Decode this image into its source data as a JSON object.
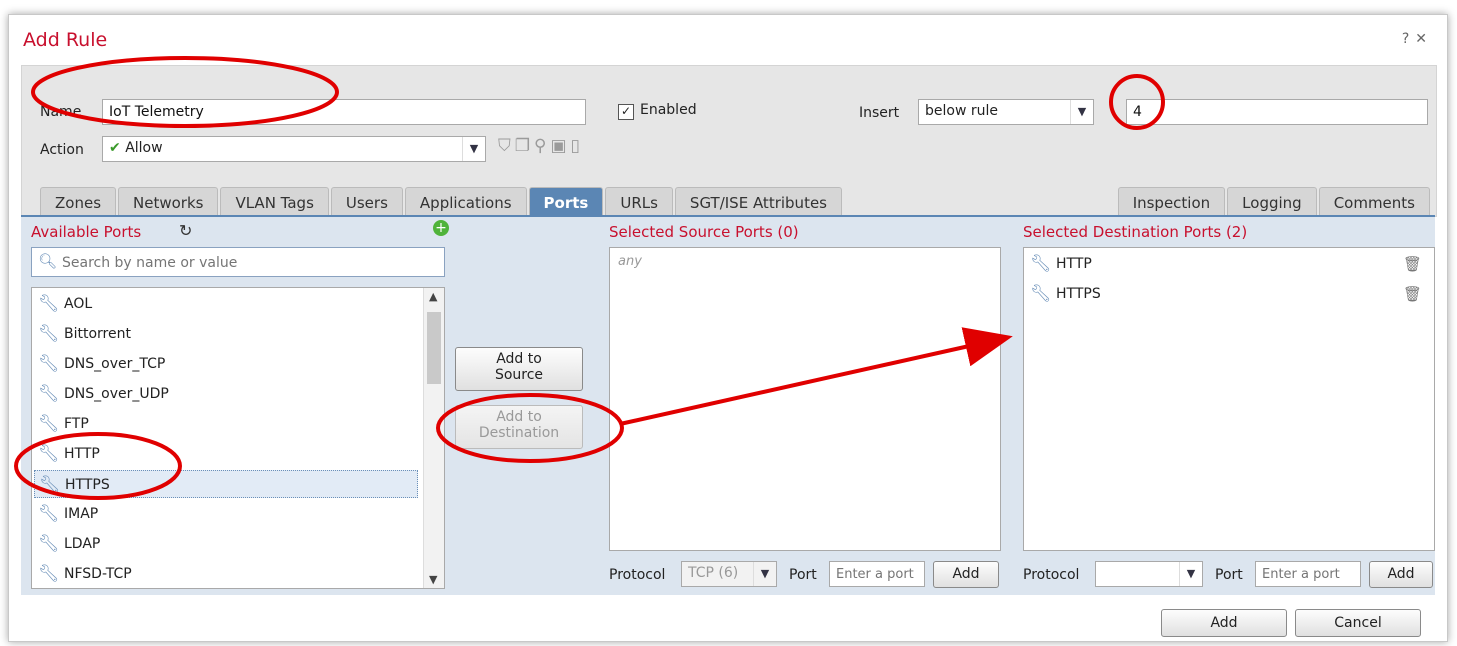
{
  "dialog": {
    "title": "Add Rule",
    "help": "?",
    "close": "✕"
  },
  "header": {
    "name_label": "Name",
    "name_value": "IoT Telemetry",
    "enabled_label": "Enabled",
    "enabled_check": "✓",
    "insert_label": "Insert",
    "insert_value": "below rule",
    "rule_number": "4",
    "action_label": "Action",
    "action_value": "Allow",
    "action_check": "✔"
  },
  "tabs_left": [
    {
      "label": "Zones"
    },
    {
      "label": "Networks"
    },
    {
      "label": "VLAN Tags"
    },
    {
      "label": "Users"
    },
    {
      "label": "Applications"
    },
    {
      "label": "Ports"
    },
    {
      "label": "URLs"
    },
    {
      "label": "SGT/ISE Attributes"
    }
  ],
  "tabs_right": [
    {
      "label": "Inspection"
    },
    {
      "label": "Logging"
    },
    {
      "label": "Comments"
    }
  ],
  "available": {
    "title": "Available Ports",
    "search_placeholder": "Search by name or value",
    "items": [
      "AOL",
      "Bittorrent",
      "DNS_over_TCP",
      "DNS_over_UDP",
      "FTP",
      "HTTP",
      "HTTPS",
      "IMAP",
      "LDAP",
      "NFSD-TCP"
    ],
    "selected_index": 6
  },
  "buttons": {
    "add_source_1": "Add to",
    "add_source_2": "Source",
    "add_dest_1": "Add to",
    "add_dest_2": "Destination"
  },
  "source": {
    "title": "Selected Source Ports (0)",
    "placeholder": "any",
    "protocol_label": "Protocol",
    "protocol_value": "TCP (6)",
    "port_label": "Port",
    "port_placeholder": "Enter a port",
    "add": "Add"
  },
  "destination": {
    "title": "Selected Destination Ports (2)",
    "items": [
      "HTTP",
      "HTTPS"
    ],
    "protocol_label": "Protocol",
    "protocol_value": "",
    "port_label": "Port",
    "port_placeholder": "Enter a port",
    "add": "Add"
  },
  "footer": {
    "add": "Add",
    "cancel": "Cancel"
  },
  "colors": {
    "accent": "#c8102e",
    "tab_active": "#5b86b4",
    "panel": "#dce5ef",
    "annotation": "#e00000"
  }
}
